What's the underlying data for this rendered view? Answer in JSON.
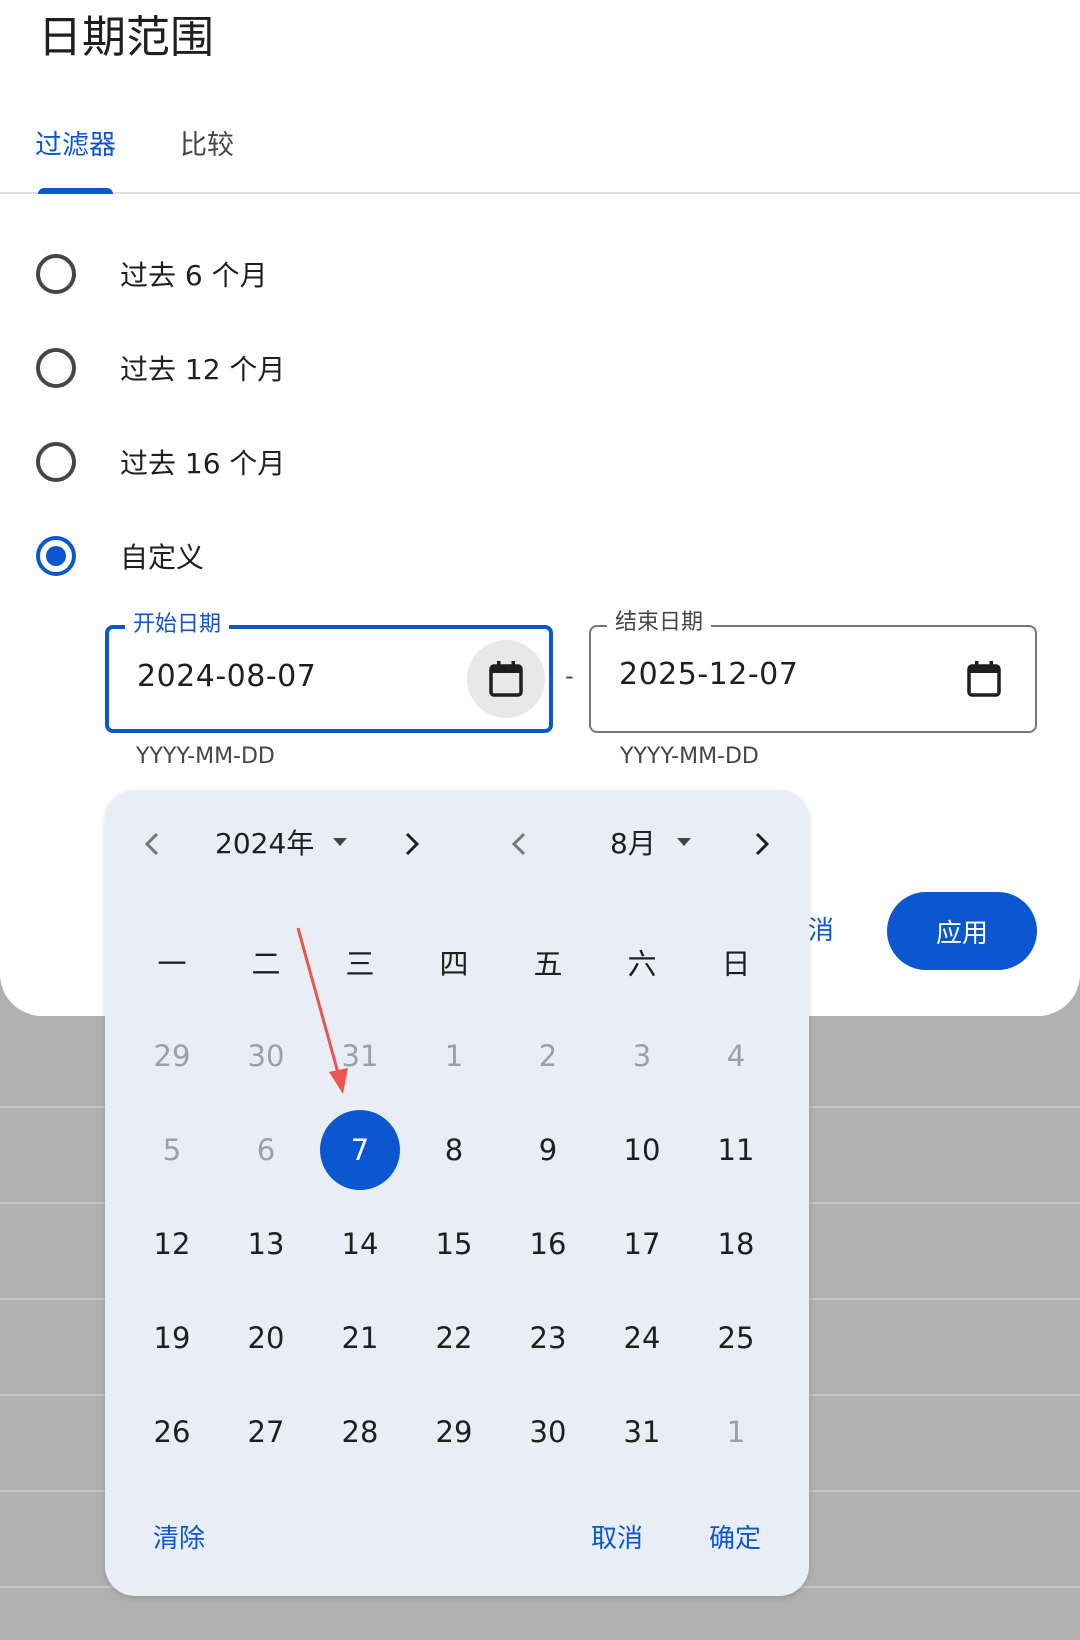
{
  "header": {
    "title": "日期范围"
  },
  "tabs": [
    {
      "label": "过滤器",
      "active": true
    },
    {
      "label": "比较",
      "active": false
    }
  ],
  "options": [
    {
      "label": "过去 6 个月",
      "checked": false
    },
    {
      "label": "过去 12 个月",
      "checked": false
    },
    {
      "label": "过去 16 个月",
      "checked": false
    },
    {
      "label": "自定义",
      "checked": true
    }
  ],
  "start_field": {
    "label": "开始日期",
    "value": "2024-08-07",
    "hint": "YYYY-MM-DD"
  },
  "separator": "-",
  "end_field": {
    "label": "结束日期",
    "value": "2025-12-07",
    "hint": "YYYY-MM-DD"
  },
  "sheet_actions": {
    "cancel": "消",
    "apply": "应用"
  },
  "picker": {
    "year_label": "2024年",
    "month_label": "8月",
    "weekdays": [
      "一",
      "二",
      "三",
      "四",
      "五",
      "六",
      "日"
    ],
    "weeks": [
      [
        {
          "d": "29",
          "m": true
        },
        {
          "d": "30",
          "m": true
        },
        {
          "d": "31",
          "m": true
        },
        {
          "d": "1",
          "m": true
        },
        {
          "d": "2",
          "m": true
        },
        {
          "d": "3",
          "m": true
        },
        {
          "d": "4",
          "m": true
        }
      ],
      [
        {
          "d": "5",
          "m": true
        },
        {
          "d": "6",
          "m": true
        },
        {
          "d": "7",
          "s": true
        },
        {
          "d": "8"
        },
        {
          "d": "9"
        },
        {
          "d": "10"
        },
        {
          "d": "11"
        }
      ],
      [
        {
          "d": "12"
        },
        {
          "d": "13"
        },
        {
          "d": "14"
        },
        {
          "d": "15"
        },
        {
          "d": "16"
        },
        {
          "d": "17"
        },
        {
          "d": "18"
        }
      ],
      [
        {
          "d": "19"
        },
        {
          "d": "20"
        },
        {
          "d": "21"
        },
        {
          "d": "22"
        },
        {
          "d": "23"
        },
        {
          "d": "24"
        },
        {
          "d": "25"
        }
      ],
      [
        {
          "d": "26"
        },
        {
          "d": "27"
        },
        {
          "d": "28"
        },
        {
          "d": "29"
        },
        {
          "d": "30"
        },
        {
          "d": "31"
        },
        {
          "d": "1",
          "m": true
        }
      ]
    ],
    "clear": "清除",
    "cancel": "取消",
    "confirm": "确定"
  },
  "colors": {
    "accent": "#0b57d0",
    "picker_bg": "#e9eef6",
    "annotation": "#ef5350"
  }
}
